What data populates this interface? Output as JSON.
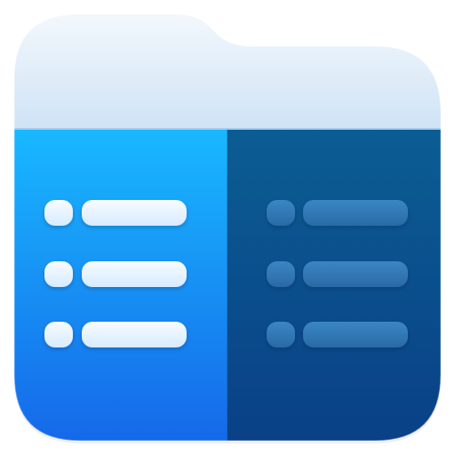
{
  "app_icon": {
    "name": "dual-pane-file-manager-app-icon",
    "colors": {
      "folder_tab_top": "#f7fafd",
      "folder_tab_bottom": "#cfe3f5",
      "left_pane_top": "#19b8ff",
      "left_pane_bottom": "#1565e8",
      "right_pane_top": "#0b5d93",
      "right_pane_bottom": "#0a3f86",
      "left_list_items": "#e8f4ff",
      "right_list_items": "#2f78b6"
    },
    "panes": [
      {
        "id": "left",
        "list_rows": 3,
        "style": "light"
      },
      {
        "id": "right",
        "list_rows": 3,
        "style": "dark"
      }
    ]
  }
}
